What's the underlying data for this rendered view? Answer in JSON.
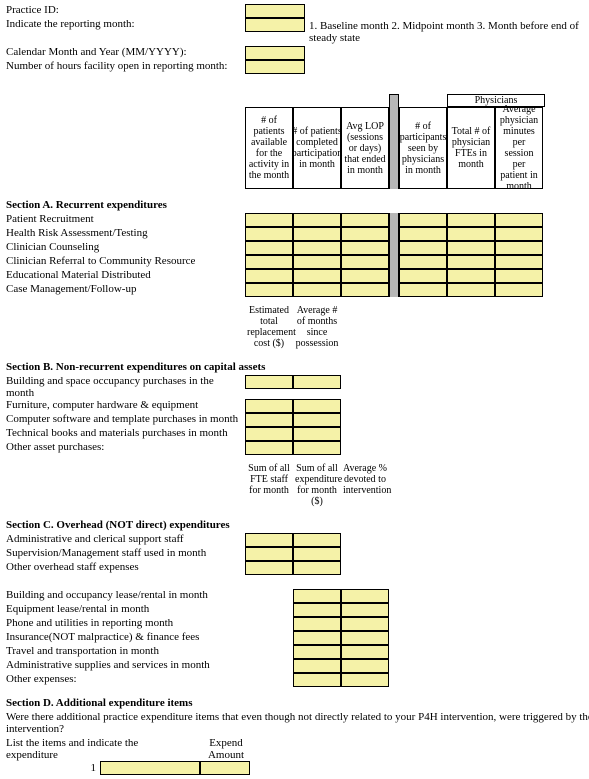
{
  "id_labels": {
    "practice_id": "Practice ID:",
    "reporting_month": "Indicate the reporting month:",
    "calendar": "Calendar Month and Year (MM/YYYY):",
    "hours": "Number of hours facility open in reporting month:"
  },
  "topnote": "1. Baseline month 2. Midpoint month 3. Month before end of steady state",
  "physicians_header": "Physicians",
  "col_headers": {
    "c1": "# of patients available for the activity in the month",
    "c2": "# of patients completed participation in month",
    "c3": "Avg LOP (sessions or days) that ended in month",
    "c4": "# of participants seen by physicians in month",
    "c5": "Total # of physician FTEs in month",
    "c6": "Average physician minutes per session per patient in month"
  },
  "sectionA": {
    "title": "Section A. Recurrent expenditures",
    "rows": {
      "r1": "Patient Recruitment",
      "r2": "Health Risk Assessment/Testing",
      "r3": "Clinician Counseling",
      "r4": "Clinician Referral to Community Resource",
      "r5": "Educational Material Distributed",
      "r6": "Case Management/Follow-up"
    }
  },
  "sectionB_hdrs": {
    "h1": "Estimated total replacement cost ($)",
    "h2": "Average # of months since possession"
  },
  "sectionB": {
    "title": "Section B. Non-recurrent expenditures on capital assets",
    "rows": {
      "r1": "Building and space occupancy purchases in the month",
      "r2": "Furniture, computer hardware & equipment",
      "r3": "Computer software and template purchases in month",
      "r4": "Technical books and materials purchases in month",
      "r5": "Other asset purchases:"
    }
  },
  "sectionC_hdrs": {
    "h1": "Sum of all FTE staff for month",
    "h2": "Sum of all expenditure for month ($)",
    "h3": "Average % devoted to intervention"
  },
  "sectionC": {
    "title": "Section C. Overhead (NOT direct) expenditures",
    "rows1": {
      "r1": "Administrative and clerical support staff",
      "r2": "Supervision/Management staff used in month",
      "r3": "Other overhead staff expenses"
    },
    "rows2": {
      "r1": "Building and occupancy lease/rental in month",
      "r2": "Equipment lease/rental in month",
      "r3": "Phone and utilities in reporting month",
      "r4": "Insurance(NOT malpractice) & finance fees",
      "r5": "Travel and transportation in month",
      "r6": "Administrative supplies and services in month",
      "r7": "Other expenses:"
    }
  },
  "sectionD": {
    "title": "Section D. Additional expenditure items",
    "question": "Were there additional practice expenditure items that even though not directly related to your P4H intervention, were triggered by the intervention?",
    "list_label": "List the items and indicate the expenditure",
    "expend_label": "Expend Amount",
    "num1": "1"
  }
}
